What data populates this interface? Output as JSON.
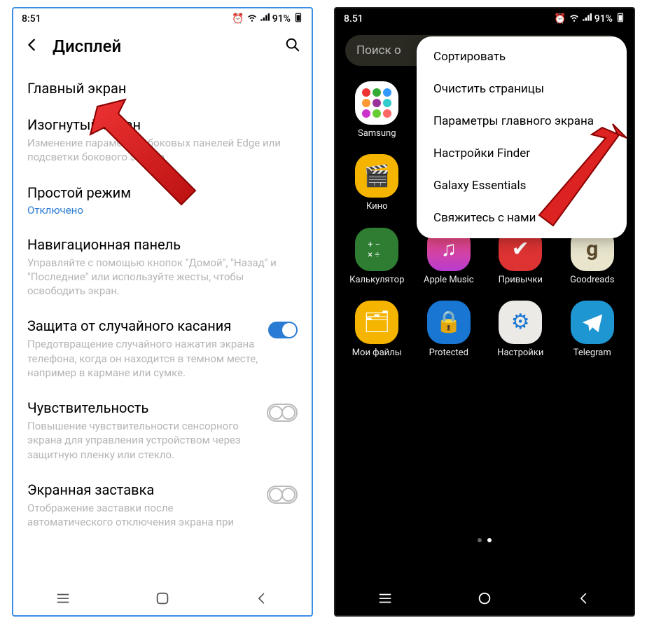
{
  "status": {
    "time_light": "8:51",
    "time_dark": "8.51",
    "battery": "91%"
  },
  "left": {
    "title": "Дисплей",
    "items": {
      "home": {
        "label": "Главный экран"
      },
      "edge": {
        "label": "Изогнутый экран",
        "desc": "Изменение параметров боковых панелей Edge или подсветки бокового экрана"
      },
      "simple": {
        "label": "Простой режим",
        "status": "Отключено"
      },
      "navpanel": {
        "label": "Навигационная панель",
        "desc": "Управляйте с помощью кнопок \"Домой\", \"Назад\" и \"Последние\" или используйте жесты, чтобы освободить экран."
      },
      "protect": {
        "label": "Защита от случайного касания",
        "desc": "Предотвращение случайного нажатия экрана телефона, когда он находится в темном месте, например в кармане или сумке."
      },
      "sensitivity": {
        "label": "Чувствительность",
        "desc": "Повышение чувствительности сенсорного экрана для управления устройством через защитную пленку или стекло."
      },
      "screensaver": {
        "label": "Экранная заставка",
        "desc": "Отображение заставки после автоматического отключения экрана при"
      }
    }
  },
  "right": {
    "search_placeholder": "Поиск о",
    "menu": {
      "sort": "Сортировать",
      "clean": "Очистить страницы",
      "homeparams": "Параметры главного экрана",
      "finder": "Настройки Finder",
      "galaxy": "Galaxy Essentials",
      "contact": "Свяжитесь с нами"
    },
    "apps": {
      "samsung": "Samsung",
      "kino": "Кино",
      "calc": "Калькулятор",
      "applemusic": "Apple Music",
      "habits": "Привычки",
      "goodreads": "Goodreads",
      "files": "Мои файлы",
      "protected": "Protected",
      "settings": "Настройки",
      "telegram": "Telegram"
    }
  }
}
